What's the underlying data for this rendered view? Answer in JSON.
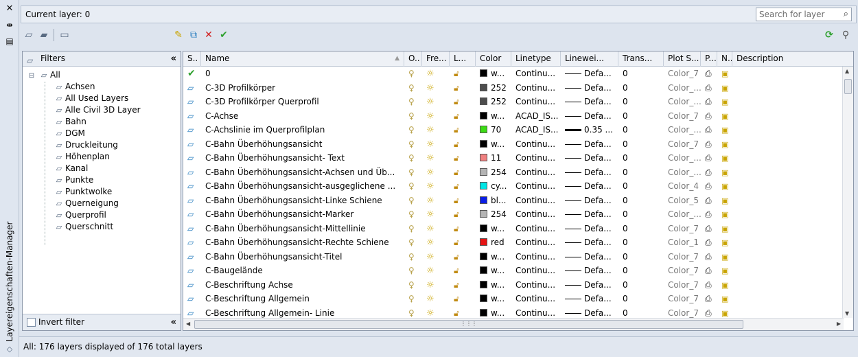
{
  "window": {
    "title": "Layereigenschaften-Manager",
    "close_icon": "close-icon",
    "autohide_icon": "autohide-icon",
    "properties_icon": "properties-icon"
  },
  "header": {
    "current_layer": "Current layer: 0",
    "search_placeholder": "Search for layer"
  },
  "filters": {
    "title": "Filters",
    "collapse": "«",
    "root": "All",
    "items": [
      "Achsen",
      "All Used Layers",
      "Alle Civil 3D Layer",
      "Bahn",
      "DGM",
      "Druckleitung",
      "Höhenplan",
      "Kanal",
      "Punkte",
      "Punktwolke",
      "Querneigung",
      "Querprofil",
      "Querschnitt"
    ],
    "invert_label": "Invert filter"
  },
  "grid": {
    "columns": [
      "S..",
      "Name",
      "O..",
      "Fre...",
      "L...",
      "Color",
      "Linetype",
      "Linewei...",
      "Trans...",
      "Plot S...",
      "P...",
      "N..",
      "Description"
    ],
    "rows": [
      {
        "name": "0",
        "current": true,
        "color": "#000000",
        "color_label": "w...",
        "linetype": "Continu...",
        "lineweight": "Defa...",
        "thick": false,
        "trans": "0",
        "plot_style": "Color_7"
      },
      {
        "name": "C-3D Profilkörper",
        "current": false,
        "color": "#4d4d4d",
        "color_label": "252",
        "linetype": "Continu...",
        "lineweight": "Defa...",
        "thick": false,
        "trans": "0",
        "plot_style": "Color_..."
      },
      {
        "name": "C-3D Profilkörper Querprofil",
        "current": false,
        "color": "#4d4d4d",
        "color_label": "252",
        "linetype": "Continu...",
        "lineweight": "Defa...",
        "thick": false,
        "trans": "0",
        "plot_style": "Color_..."
      },
      {
        "name": "C-Achse",
        "current": false,
        "color": "#000000",
        "color_label": "w...",
        "linetype": "ACAD_IS...",
        "lineweight": "Defa...",
        "thick": false,
        "trans": "0",
        "plot_style": "Color_7"
      },
      {
        "name": "C-Achslinie im Querprofilplan",
        "current": false,
        "color": "#3cdc14",
        "color_label": "70",
        "linetype": "ACAD_IS...",
        "lineweight": "0.35 ...",
        "thick": true,
        "trans": "0",
        "plot_style": "Color_..."
      },
      {
        "name": "C-Bahn Überhöhungsansicht",
        "current": false,
        "color": "#000000",
        "color_label": "w...",
        "linetype": "Continu...",
        "lineweight": "Defa...",
        "thick": false,
        "trans": "0",
        "plot_style": "Color_7"
      },
      {
        "name": "C-Bahn Überhöhungsansicht- Text",
        "current": false,
        "color": "#f08080",
        "color_label": "11",
        "linetype": "Continu...",
        "lineweight": "Defa...",
        "thick": false,
        "trans": "0",
        "plot_style": "Color_..."
      },
      {
        "name": "C-Bahn Überhöhungsansicht-Achsen und Üb...",
        "current": false,
        "color": "#b4b4b4",
        "color_label": "254",
        "linetype": "Continu...",
        "lineweight": "Defa...",
        "thick": false,
        "trans": "0",
        "plot_style": "Color_..."
      },
      {
        "name": "C-Bahn Überhöhungsansicht-ausgeglichene ...",
        "current": false,
        "color": "#00e6e6",
        "color_label": "cy...",
        "linetype": "Continu...",
        "lineweight": "Defa...",
        "thick": false,
        "trans": "0",
        "plot_style": "Color_4"
      },
      {
        "name": "C-Bahn Überhöhungsansicht-Linke Schiene",
        "current": false,
        "color": "#0a1ee6",
        "color_label": "bl...",
        "linetype": "Continu...",
        "lineweight": "Defa...",
        "thick": false,
        "trans": "0",
        "plot_style": "Color_5"
      },
      {
        "name": "C-Bahn Überhöhungsansicht-Marker",
        "current": false,
        "color": "#b4b4b4",
        "color_label": "254",
        "linetype": "Continu...",
        "lineweight": "Defa...",
        "thick": false,
        "trans": "0",
        "plot_style": "Color_..."
      },
      {
        "name": "C-Bahn Überhöhungsansicht-Mittellinie",
        "current": false,
        "color": "#000000",
        "color_label": "w...",
        "linetype": "Continu...",
        "lineweight": "Defa...",
        "thick": false,
        "trans": "0",
        "plot_style": "Color_7"
      },
      {
        "name": "C-Bahn Überhöhungsansicht-Rechte Schiene",
        "current": false,
        "color": "#e61414",
        "color_label": "red",
        "linetype": "Continu...",
        "lineweight": "Defa...",
        "thick": false,
        "trans": "0",
        "plot_style": "Color_1"
      },
      {
        "name": "C-Bahn Überhöhungsansicht-Titel",
        "current": false,
        "color": "#000000",
        "color_label": "w...",
        "linetype": "Continu...",
        "lineweight": "Defa...",
        "thick": false,
        "trans": "0",
        "plot_style": "Color_7"
      },
      {
        "name": "C-Baugelände",
        "current": false,
        "color": "#000000",
        "color_label": "w...",
        "linetype": "Continu...",
        "lineweight": "Defa...",
        "thick": false,
        "trans": "0",
        "plot_style": "Color_7"
      },
      {
        "name": "C-Beschriftung Achse",
        "current": false,
        "color": "#000000",
        "color_label": "w...",
        "linetype": "Continu...",
        "lineweight": "Defa...",
        "thick": false,
        "trans": "0",
        "plot_style": "Color_7"
      },
      {
        "name": "C-Beschriftung Allgemein",
        "current": false,
        "color": "#000000",
        "color_label": "w...",
        "linetype": "Continu...",
        "lineweight": "Defa...",
        "thick": false,
        "trans": "0",
        "plot_style": "Color_7"
      },
      {
        "name": "C-Beschriftung Allgemein- Linie",
        "current": false,
        "color": "#000000",
        "color_label": "w...",
        "linetype": "Continu...",
        "lineweight": "Defa...",
        "thick": false,
        "trans": "0",
        "plot_style": "Color_7"
      }
    ]
  },
  "status": {
    "text": "All: 176 layers displayed of 176 total layers"
  }
}
